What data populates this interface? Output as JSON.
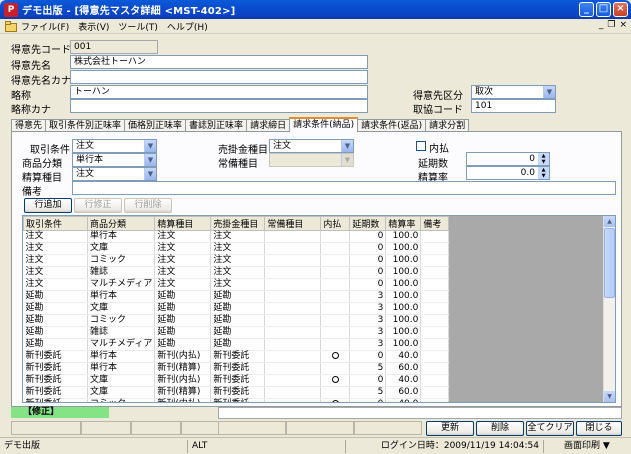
{
  "window": {
    "title": "デモ出版 - [得意先マスタ詳細 <MST-402>]",
    "app_icon": "P",
    "minimize": "_",
    "maximize": "□",
    "close": "×"
  },
  "menu": {
    "items": [
      "ファイル(F)",
      "表示(V)",
      "ツール(T)",
      "ヘルプ(H)"
    ],
    "mdi_min": "_",
    "mdi_restore": "❐",
    "mdi_close": "×"
  },
  "form": {
    "customer_code_label": "得意先コード",
    "customer_code": "001",
    "customer_name_label": "得意先名",
    "customer_name": "株式会社トーハン",
    "customer_kana_label": "得意先名カナ",
    "customer_kana": "",
    "short_name_label": "略称",
    "short_name": "トーハン",
    "short_kana_label": "略称カナ",
    "short_kana": "",
    "customer_type_label": "得意先区分",
    "customer_type": "取次",
    "assoc_code_label": "取協コード",
    "assoc_code": "101"
  },
  "tabs": [
    "得意先",
    "取引条件別正味率",
    "価格別正味率",
    "書誌別正味率",
    "請求締日",
    "請求条件(納品)",
    "請求条件(返品)",
    "請求分割"
  ],
  "active_tab": 5,
  "detail": {
    "trade_cond_label": "取引条件",
    "trade_cond": "注文",
    "product_cat_label": "商品分類",
    "product_cat": "単行本",
    "settle_type_label": "精算種目",
    "settle_type": "注文",
    "receivable_type_label": "売掛金種目",
    "receivable_type": "注文",
    "regular_type_label": "常備種目",
    "regular_type": "",
    "internal_label": "内払",
    "extension_label": "延期数",
    "extension": "0",
    "settle_rate_label": "精算率",
    "settle_rate": "0.0",
    "note_label": "備考",
    "note": ""
  },
  "row_buttons": {
    "add": "行追加",
    "edit": "行修正",
    "delete": "行削除"
  },
  "grid": {
    "columns": [
      "取引条件",
      "商品分類",
      "精算種目",
      "売掛金種目",
      "常備種目",
      "内払",
      "延期数",
      "精算率",
      "備考"
    ],
    "rows": [
      [
        "注文",
        "単行本",
        "注文",
        "注文",
        "",
        false,
        "0",
        "100.0",
        ""
      ],
      [
        "注文",
        "文庫",
        "注文",
        "注文",
        "",
        false,
        "0",
        "100.0",
        ""
      ],
      [
        "注文",
        "コミック",
        "注文",
        "注文",
        "",
        false,
        "0",
        "100.0",
        ""
      ],
      [
        "注文",
        "雑誌",
        "注文",
        "注文",
        "",
        false,
        "0",
        "100.0",
        ""
      ],
      [
        "注文",
        "マルチメディア",
        "注文",
        "注文",
        "",
        false,
        "0",
        "100.0",
        ""
      ],
      [
        "延勘",
        "単行本",
        "延勘",
        "延勘",
        "",
        false,
        "3",
        "100.0",
        ""
      ],
      [
        "延勘",
        "文庫",
        "延勘",
        "延勘",
        "",
        false,
        "3",
        "100.0",
        ""
      ],
      [
        "延勘",
        "コミック",
        "延勘",
        "延勘",
        "",
        false,
        "3",
        "100.0",
        ""
      ],
      [
        "延勘",
        "雑誌",
        "延勘",
        "延勘",
        "",
        false,
        "3",
        "100.0",
        ""
      ],
      [
        "延勘",
        "マルチメディア",
        "延勘",
        "延勘",
        "",
        false,
        "3",
        "100.0",
        ""
      ],
      [
        "新刊委託",
        "単行本",
        "新刊(内払)",
        "新刊委託",
        "",
        true,
        "0",
        "40.0",
        ""
      ],
      [
        "新刊委託",
        "単行本",
        "新刊(精算)",
        "新刊委託",
        "",
        false,
        "5",
        "60.0",
        ""
      ],
      [
        "新刊委託",
        "文庫",
        "新刊(内払)",
        "新刊委託",
        "",
        true,
        "0",
        "40.0",
        ""
      ],
      [
        "新刊委託",
        "文庫",
        "新刊(精算)",
        "新刊委託",
        "",
        false,
        "5",
        "60.0",
        ""
      ],
      [
        "新刊委託",
        "コミック",
        "新刊(内払)",
        "新刊委託",
        "",
        true,
        "0",
        "40.0",
        ""
      ]
    ]
  },
  "mode_label": "【修正】",
  "footer_buttons": {
    "update": "更新",
    "delete": "削除",
    "clear": "全てクリア",
    "close": "閉じる"
  },
  "status": {
    "company": "デモ出版",
    "key": "ALT",
    "login": "ログイン日時：2009/11/19 14:04:54",
    "print": "画面印刷"
  }
}
